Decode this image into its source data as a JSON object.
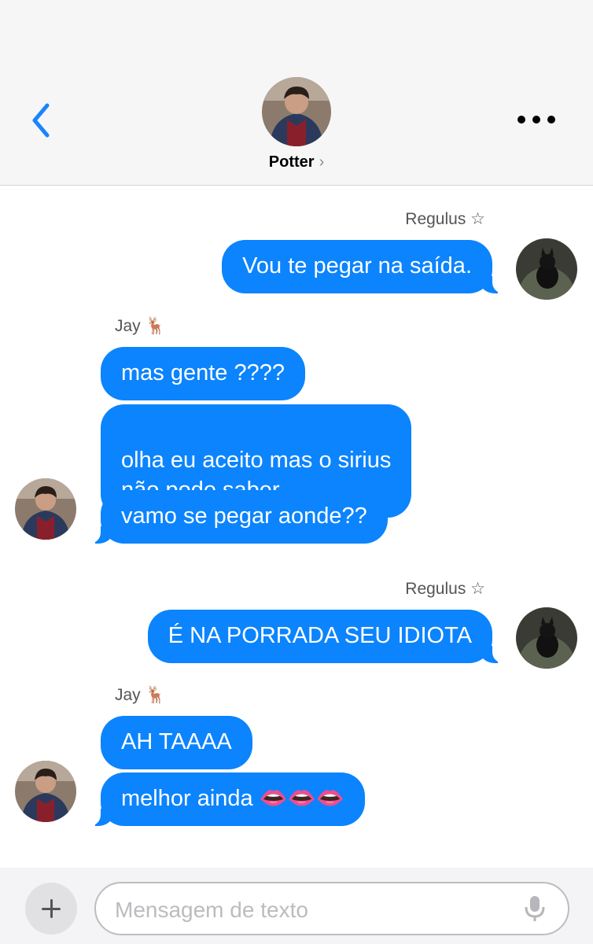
{
  "header": {
    "contact_name": "Potter",
    "chevron": "›",
    "back_icon": "chevron-left-icon",
    "more_icon": "ellipsis-icon"
  },
  "messages": [
    {
      "sender": "Regulus ☆",
      "side": "right",
      "bubbles": [
        "Vou te pegar na saída."
      ]
    },
    {
      "sender": "Jay 🦌",
      "side": "left",
      "bubbles": [
        "mas gente ????",
        "olha eu aceito mas o sirius\nnão pode saber",
        "vamo se pegar aonde??"
      ]
    },
    {
      "sender": "Regulus ☆",
      "side": "right",
      "bubbles": [
        "É NA PORRADA SEU IDIOTA"
      ]
    },
    {
      "sender": "Jay 🦌",
      "side": "left",
      "bubbles": [
        "AH TAAAA",
        "melhor ainda 👄👄👄"
      ]
    }
  ],
  "composer": {
    "placeholder": "Mensagem de texto",
    "plus_icon": "plus-icon",
    "mic_icon": "microphone-icon"
  },
  "colors": {
    "bubble": "#0b84fe",
    "header_bg": "#f6f6f6",
    "accent": "#1a84fe"
  }
}
